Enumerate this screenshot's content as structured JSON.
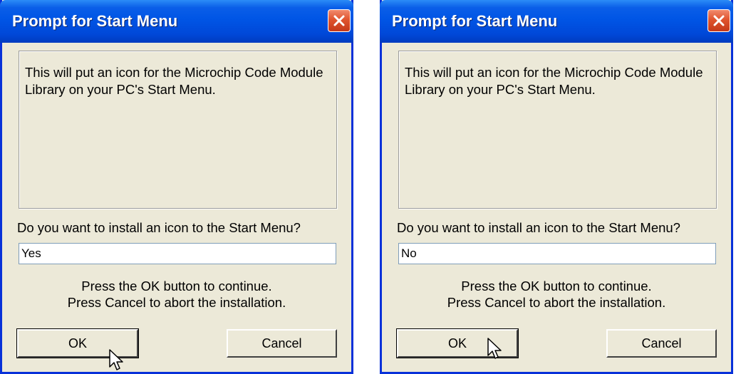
{
  "dialogs": [
    {
      "title": "Prompt for Start Menu",
      "message": "This will put an icon for the Microchip Code Module Library on your PC's Start Menu.",
      "question": "Do you want to install an icon to the Start Menu?",
      "answer_value": "Yes",
      "instruction_line1": "Press the OK button to continue.",
      "instruction_line2": "Press Cancel to abort the installation.",
      "ok_label": "OK",
      "cancel_label": "Cancel"
    },
    {
      "title": "Prompt for Start Menu",
      "message": "This will put an icon for the Microchip Code Module Library on your PC's Start Menu.",
      "question": "Do you want to install an icon to the Start Menu?",
      "answer_value": "No",
      "instruction_line1": "Press the OK button to continue.",
      "instruction_line2": "Press Cancel to abort the installation.",
      "ok_label": "OK",
      "cancel_label": "Cancel"
    }
  ],
  "icons": {
    "close": "close-x-icon",
    "cursor": "mouse-pointer-icon"
  },
  "colors": {
    "titlebar": "#0055e5",
    "dialog_bg": "#ece9d8",
    "close_button": "#e0542e"
  }
}
